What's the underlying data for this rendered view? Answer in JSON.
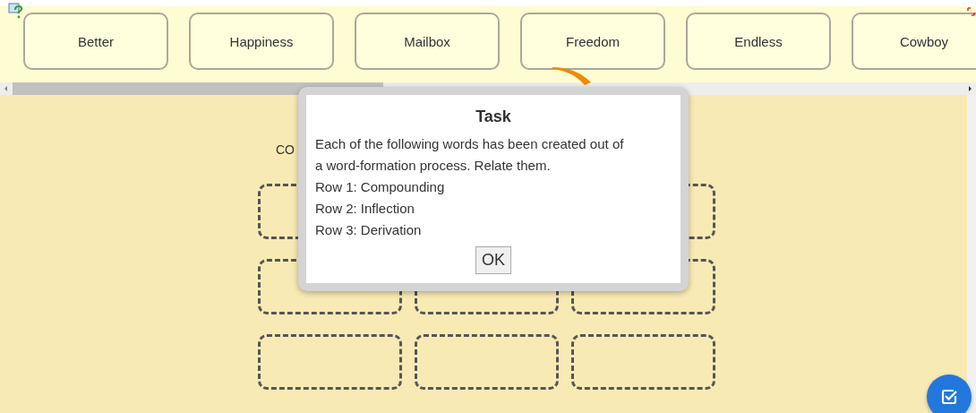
{
  "word_cards": [
    {
      "label": "Better"
    },
    {
      "label": "Happiness"
    },
    {
      "label": "Mailbox"
    },
    {
      "label": "Freedom"
    },
    {
      "label": "Endless"
    },
    {
      "label": "Cowboy"
    }
  ],
  "board": {
    "heading": "CO"
  },
  "dialog": {
    "title": "Task",
    "lines": [
      "Each of the following words has been created out of",
      "a word-formation process. Relate them.",
      "Row 1: Compounding",
      "Row 2: Inflection",
      "Row 3: Derivation"
    ],
    "button": "OK"
  }
}
